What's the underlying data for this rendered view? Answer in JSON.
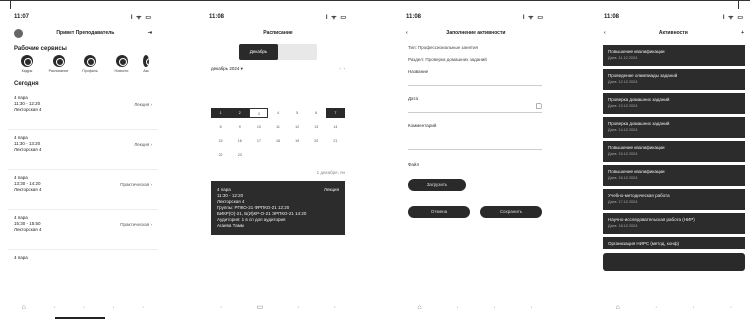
{
  "screen1": {
    "time": "11:07",
    "status_icons": "l ᯤ ▭",
    "title": "Привет Преподаватель",
    "services_title": "Рабочие сервисы",
    "services": [
      "Кадры",
      "Расписание",
      "Профиль",
      "Новости",
      "Акк"
    ],
    "today_title": "Сегодня",
    "lessons": [
      {
        "pair": "4 пара",
        "time": "11:30 - 12:20",
        "room": "Лекторская 4",
        "type": "Лекция"
      },
      {
        "pair": "4 пара",
        "time": "11:30 - 13:20",
        "room": "Лекторская 4",
        "type": "Лекция"
      },
      {
        "pair": "4 пара",
        "time": "13:30 - 14:20",
        "room": "Лекторская 4",
        "type": "Практическая"
      },
      {
        "pair": "4 пара",
        "time": "15:30 - 15:50",
        "room": "Лекторская 4",
        "type": "Практическая"
      },
      {
        "pair": "4 пара",
        "time": "",
        "room": "",
        "type": ""
      }
    ]
  },
  "screen2": {
    "time": "11:08",
    "status_icons": "l ᯤ ▭",
    "title": "Расписание",
    "seg_on": "Декабрь",
    "month": "декабрь 2024",
    "cal": [
      "1",
      "2",
      "3",
      "4",
      "5",
      "6",
      "7",
      "8",
      "9",
      "10",
      "11",
      "12",
      "13",
      "14",
      "15",
      "16",
      "17",
      "18",
      "19",
      "20",
      "21",
      "22",
      "23",
      "24",
      "25",
      "26",
      "27",
      "28"
    ],
    "today_date": "1 декабря, пн",
    "card": {
      "pair": "4 пара",
      "type": "Лекция",
      "time": "11:30 - 12:20",
      "room": "Лекторская 4",
      "groups": "Группы: РПКО-21 ФРПКО-21 12:20",
      "groups2": "БИКР(О)-21, Б(И)КР-О-21 ЭРПКО-21 14:20",
      "aud": "Аудитория: 1 в сп доп аудитория",
      "teacher": "Агаева Тамм"
    }
  },
  "screen3": {
    "time": "11:08",
    "status_icons": "l ᯤ ▭",
    "title": "Заполнение активности",
    "type_line": "Тип: Профессиональные занятия",
    "section_line": "Раздел: Проверка домашних заданий",
    "name_label": "Название",
    "date_label": "Дата",
    "comment_label": "Комментарий",
    "files_label": "Файл",
    "btn1": "Загрузить",
    "btn2": "Отмена",
    "btn3": "Сохранить"
  },
  "screen4": {
    "time": "11:08",
    "status_icons": "l ᯤ ▭",
    "title": "Активности",
    "items": [
      {
        "title": "Повышение квалификации",
        "date": "Дата: 11.12.2024"
      },
      {
        "title": "Проведение олимпиады заданий",
        "date": "Дата: 12.12.2024"
      },
      {
        "title": "Проверка домашних заданий",
        "date": "Дата: 13.12.2024"
      },
      {
        "title": "Проверка домашних заданий",
        "date": "Дата: 14.12.2024"
      },
      {
        "title": "Повышение квалификации",
        "date": "Дата: 15.12.2024"
      },
      {
        "title": "Повышение квалификации",
        "date": "Дата: 16.12.2024"
      },
      {
        "title": "Учебно-методическая работа",
        "date": "Дата: 17.12.2024"
      },
      {
        "title": "Научно-исследовательская работа (НИР)",
        "date": "Дата: 18.12.2024"
      },
      {
        "title": "Организация НИРС (метод, конф)",
        "date": ""
      }
    ]
  }
}
